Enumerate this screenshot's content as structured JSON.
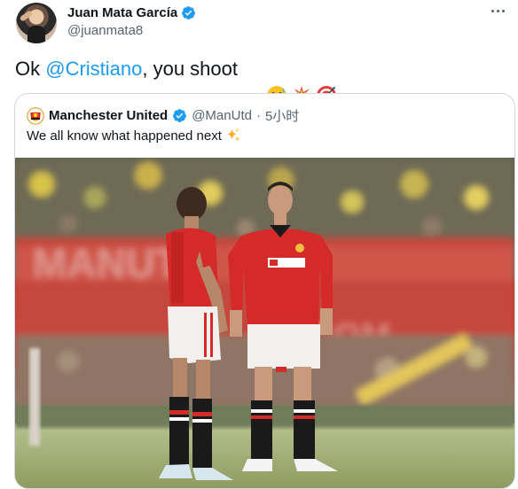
{
  "author": {
    "name": "Juan Mata García",
    "handle": "@juanmata8"
  },
  "tweet": {
    "prefix": "Ok ",
    "mention": "@Cristiano",
    "suffix": ", you shoot",
    "emojis": [
      "sweat-smile-emoji",
      "collision-emoji",
      "direct-hit-emoji"
    ]
  },
  "quoted": {
    "name": "Manchester United",
    "handle": "@ManUtd",
    "separator": "·",
    "time": "5小时",
    "text": "We all know what happened next",
    "emoji": "sparkles-emoji",
    "image_alt": "Two Manchester United players in red shirts and white shorts standing on the pitch in front of a crowd"
  },
  "colors": {
    "accent": "#1d9bf0",
    "text": "#0f1419",
    "secondary": "#536471",
    "border": "#cfd9de",
    "kit_red": "#d42a2a"
  }
}
